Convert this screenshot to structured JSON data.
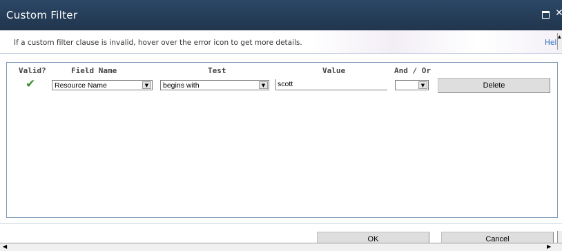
{
  "dialog": {
    "title": "Custom Filter",
    "instructions": "If a custom filter clause is invalid, hover over the error icon to get more details.",
    "help_label": "Help"
  },
  "columns": {
    "valid": "Valid?",
    "field_name": "Field Name",
    "test": "Test",
    "value": "Value",
    "and_or": "And / Or"
  },
  "rows": [
    {
      "valid_icon": "checkmark-icon",
      "field_name": "Resource Name",
      "test": "begins with",
      "value": "scott",
      "and_or": "",
      "delete_label": "Delete"
    }
  ],
  "footer": {
    "ok_label": "OK",
    "cancel_label": "Cancel"
  },
  "colors": {
    "titlebar": "#2b4766",
    "valid_check": "#3a8d2a",
    "link": "#2a6ebb"
  }
}
